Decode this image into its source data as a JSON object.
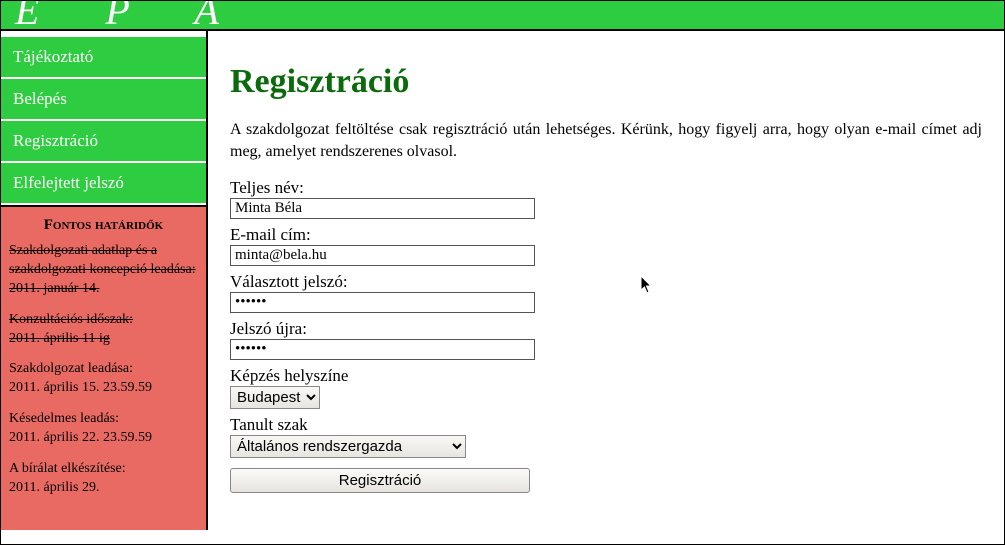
{
  "topbar": {
    "logo_text": "E P A"
  },
  "sidebar": {
    "nav": [
      {
        "label": "Tájékoztató"
      },
      {
        "label": "Belépés"
      },
      {
        "label": "Regisztráció"
      },
      {
        "label": "Elfelejtett jelszó"
      }
    ],
    "deadlines": {
      "title": "Fontos határidők",
      "items": [
        {
          "text": "Szakdolgozati adatlap és a szakdolgozati koncepció leadása:\n2011. január 14.",
          "struck": true
        },
        {
          "text": "Konzultációs időszak:\n2011. április 11 ig",
          "struck": true
        },
        {
          "text": "Szakdolgozat leadása:\n2011. április 15. 23.59.59",
          "struck": false
        },
        {
          "text": "Késedelmes leadás:\n2011. április 22. 23.59.59",
          "struck": false
        },
        {
          "text": "A bírálat elkészítése:\n2011. április 29.",
          "struck": false
        }
      ]
    }
  },
  "main": {
    "heading": "Regisztráció",
    "intro": "A szakdolgozat feltöltése csak regisztráció után lehetséges. Kérünk, hogy figyelj arra, hogy olyan e-mail címet adj meg, amelyet rendszerenes olvasol.",
    "form": {
      "fullname_label": "Teljes név:",
      "fullname_value": "Minta Béla",
      "email_label": "E-mail cím:",
      "email_value": "minta@bela.hu",
      "password_label": "Választott jelszó:",
      "password_value": "••••••",
      "password2_label": "Jelszó újra:",
      "password2_value": "••••••",
      "location_label": "Képzés helyszíne",
      "location_value": "Budapest",
      "major_label": "Tanult szak",
      "major_value": "Általános rendszergazda",
      "submit_label": "Regisztráció"
    }
  }
}
